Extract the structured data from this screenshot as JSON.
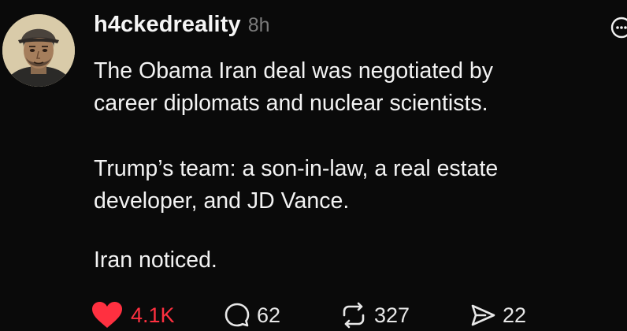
{
  "post": {
    "username": "h4ckedreality",
    "time": "8h",
    "paragraphs": [
      "The Obama Iran deal was negotiated by\ncareer diplomats and nuclear scientists.",
      "Trump’s team: a son-in-law, a real estate\ndeveloper, and JD Vance.",
      "Iran noticed."
    ],
    "actions": {
      "likes": "4.1K",
      "replies": "62",
      "reposts": "327",
      "shares": "22"
    }
  },
  "colors": {
    "background": "#0a0a0a",
    "text": "#f3f3f3",
    "muted": "#7b7b7b",
    "like": "#ff3040"
  },
  "icons": {
    "avatar": "avatar-illustration",
    "more": "more-options-icon",
    "like": "heart-icon",
    "reply": "comment-bubble-icon",
    "repost": "repost-icon",
    "share": "share-send-icon"
  }
}
